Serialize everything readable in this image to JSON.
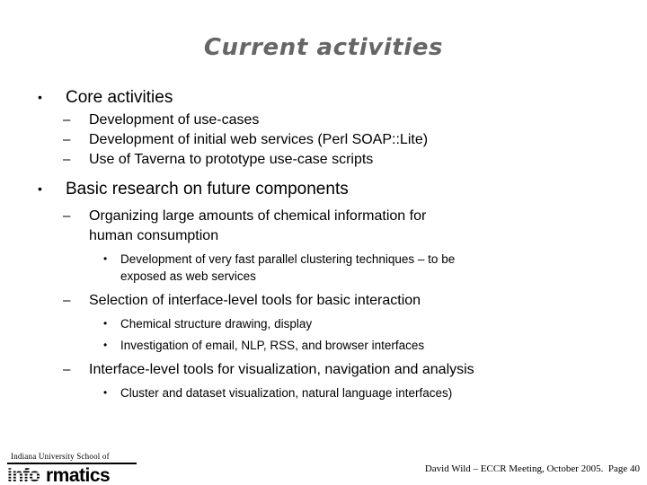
{
  "slide": {
    "title": "Current activities",
    "title_color": "#666666",
    "background_color": "#ffffff",
    "text_color": "#000000"
  },
  "markers": {
    "level1": "•",
    "level2": "–",
    "level3": "•"
  },
  "outline": [
    {
      "level": 1,
      "text": "Core activities"
    },
    {
      "level": 2,
      "text": "Development of use-cases"
    },
    {
      "level": 2,
      "text": "Development of initial web services (Perl SOAP::Lite)"
    },
    {
      "level": 2,
      "text": "Use of Taverna to prototype use-case scripts"
    },
    {
      "level": 1,
      "text": "Basic research on future components"
    },
    {
      "level": 2,
      "text": "Organizing large amounts of chemical information for human consumption"
    },
    {
      "level": 3,
      "text": "Development of very fast parallel clustering techniques – to be exposed as web services"
    },
    {
      "level": 2,
      "text": "Selection of interface-level tools for basic interaction"
    },
    {
      "level": 3,
      "text": "Chemical structure drawing, display"
    },
    {
      "level": 3,
      "text": "Investigation of email, NLP, RSS, and browser interfaces"
    },
    {
      "level": 2,
      "text": "Interface-level tools for visualization, navigation and analysis"
    },
    {
      "level": 3,
      "text": "Cluster and dataset visualization, natural language interfaces)"
    }
  ],
  "footer": {
    "note": "David Wild – ECCR Meeting, October 2005.  Page 40",
    "presenter": "David Wild",
    "event": "ECCR Meeting, October 2005.",
    "page_number": "40"
  },
  "logo": {
    "top_text": "Indiana University School of",
    "wordmark": "informatics"
  }
}
